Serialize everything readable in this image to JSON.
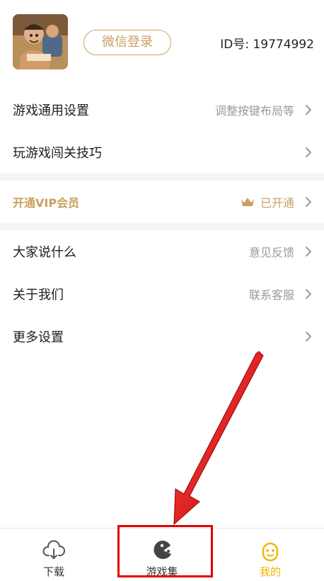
{
  "profile": {
    "login_button": "微信登录",
    "user_id": "ID号: 19774992"
  },
  "settings": [
    {
      "label": "游戏通用设置",
      "value": "调整按键布局等"
    },
    {
      "label": "玩游戏闯关技巧",
      "value": ""
    }
  ],
  "vip": {
    "label": "开通VIP会员",
    "value": "已开通"
  },
  "more": [
    {
      "label": "大家说什么",
      "value": "意见反馈"
    },
    {
      "label": "关于我们",
      "value": "联系客服"
    },
    {
      "label": "更多设置",
      "value": ""
    }
  ],
  "tabbar": {
    "tabs": [
      {
        "label": "下载",
        "icon": "cloud-download-icon"
      },
      {
        "label": "游戏集",
        "icon": "pacman-icon"
      },
      {
        "label": "我的",
        "icon": "smiley-face-icon",
        "active": true
      }
    ]
  },
  "colors": {
    "accent_gold": "#c9a063",
    "active_tab": "#f0b400",
    "annotation_red": "#e10000"
  }
}
